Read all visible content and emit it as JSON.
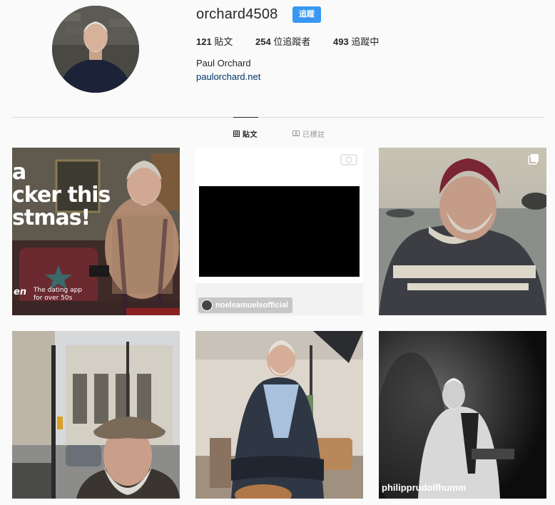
{
  "profile": {
    "username": "orchard4508",
    "follow_label": "追蹤",
    "stats": [
      {
        "count": "121",
        "label": " 貼文"
      },
      {
        "count": "254",
        "label": " 位追蹤者"
      },
      {
        "count": "493",
        "label": " 追蹤中"
      }
    ],
    "full_name": "Paul Orchard",
    "website": "paulorchard.net"
  },
  "tabs": [
    {
      "label": "貼文",
      "icon": "grid-icon",
      "active": true
    },
    {
      "label": "已標註",
      "icon": "tagged-icon",
      "active": false
    }
  ],
  "posts": [
    {
      "kind": "ad",
      "ad_lines": [
        "a",
        "cker this",
        "stmas!"
      ],
      "brand": "en",
      "tagline": "The dating app\nfor over 50s"
    },
    {
      "kind": "video",
      "tag_user": "noelsamuelsofficial"
    },
    {
      "kind": "multi"
    },
    {
      "kind": "photo"
    },
    {
      "kind": "photo"
    },
    {
      "kind": "photo",
      "credit": "philipprudolfhumm"
    }
  ],
  "colors": {
    "follow_button": "#3897f0",
    "link": "#003569",
    "background": "#fafafa",
    "divider": "#dbdbdb"
  }
}
